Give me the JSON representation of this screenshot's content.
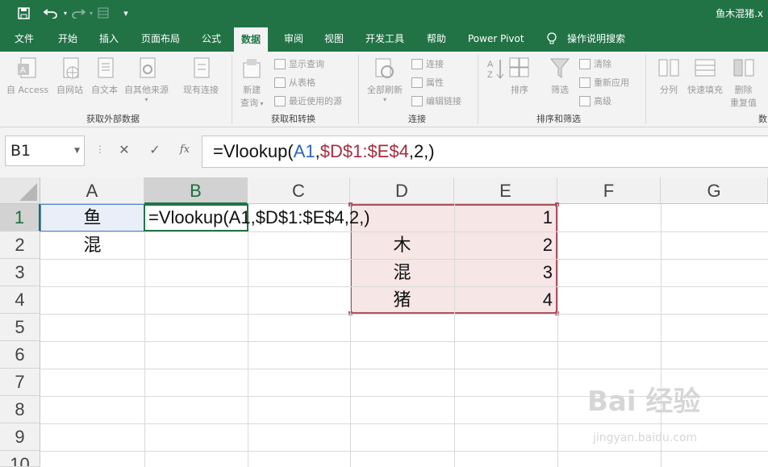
{
  "window": {
    "title": "鱼木混猪.x"
  },
  "tabs": [
    {
      "label": "文件"
    },
    {
      "label": "开始"
    },
    {
      "label": "插入"
    },
    {
      "label": "页面布局"
    },
    {
      "label": "公式"
    },
    {
      "label": "数据",
      "active": true
    },
    {
      "label": "审阅"
    },
    {
      "label": "视图"
    },
    {
      "label": "开发工具"
    },
    {
      "label": "帮助"
    },
    {
      "label": "Power Pivot"
    },
    {
      "label": "操作说明搜索"
    }
  ],
  "ribbon": {
    "get_external": {
      "label": "获取外部数据",
      "buttons": [
        "自 Access",
        "自网站",
        "自文本",
        "自其他来源",
        "现有连接"
      ]
    },
    "get_transform": {
      "label": "获取和转换",
      "new_query": "新建",
      "new_query_line2": "查询",
      "small": [
        "显示查询",
        "从表格",
        "最近使用的源"
      ]
    },
    "connections": {
      "label": "连接",
      "refresh_all": "全部刷新",
      "small": [
        "连接",
        "属性",
        "编辑链接"
      ]
    },
    "sort_filter": {
      "label": "排序和筛选",
      "sort": "排序",
      "filter": "筛选",
      "small": [
        "清除",
        "重新应用",
        "高级"
      ]
    },
    "data_tools": {
      "label_partial": "数",
      "buttons": [
        "分列",
        "快速填充",
        "删除",
        "重复值"
      ]
    }
  },
  "formula_bar": {
    "name_box": "B1",
    "fx": "fx",
    "formula_parts": {
      "pre": "=Vlookup(",
      "ref1": "A1",
      "sep1": ",",
      "ref2": "$D$1:$E$4",
      "post": ",2,)"
    }
  },
  "grid": {
    "columns": [
      "A",
      "B",
      "C",
      "D",
      "E",
      "F",
      "G"
    ],
    "rows": [
      "1",
      "2",
      "3",
      "4",
      "5",
      "6",
      "7",
      "8",
      "9",
      "10"
    ],
    "selected_column": "B",
    "selected_row": "1",
    "cells": {
      "A1": "鱼",
      "A2": "混",
      "B1": "=Vlookup(A1,$D$1:$E$4,2,)",
      "D2": "木",
      "D3": "混",
      "D4": "猪",
      "E1": "1",
      "E2": "2",
      "E3": "3",
      "E4": "4"
    }
  },
  "watermark": {
    "main": "Bai 经验",
    "sub": "jingyan.baidu.com"
  },
  "colors": {
    "excel_green": "#217346",
    "ref_blue": "#2e63b8",
    "ref_red": "#a52c3e"
  }
}
